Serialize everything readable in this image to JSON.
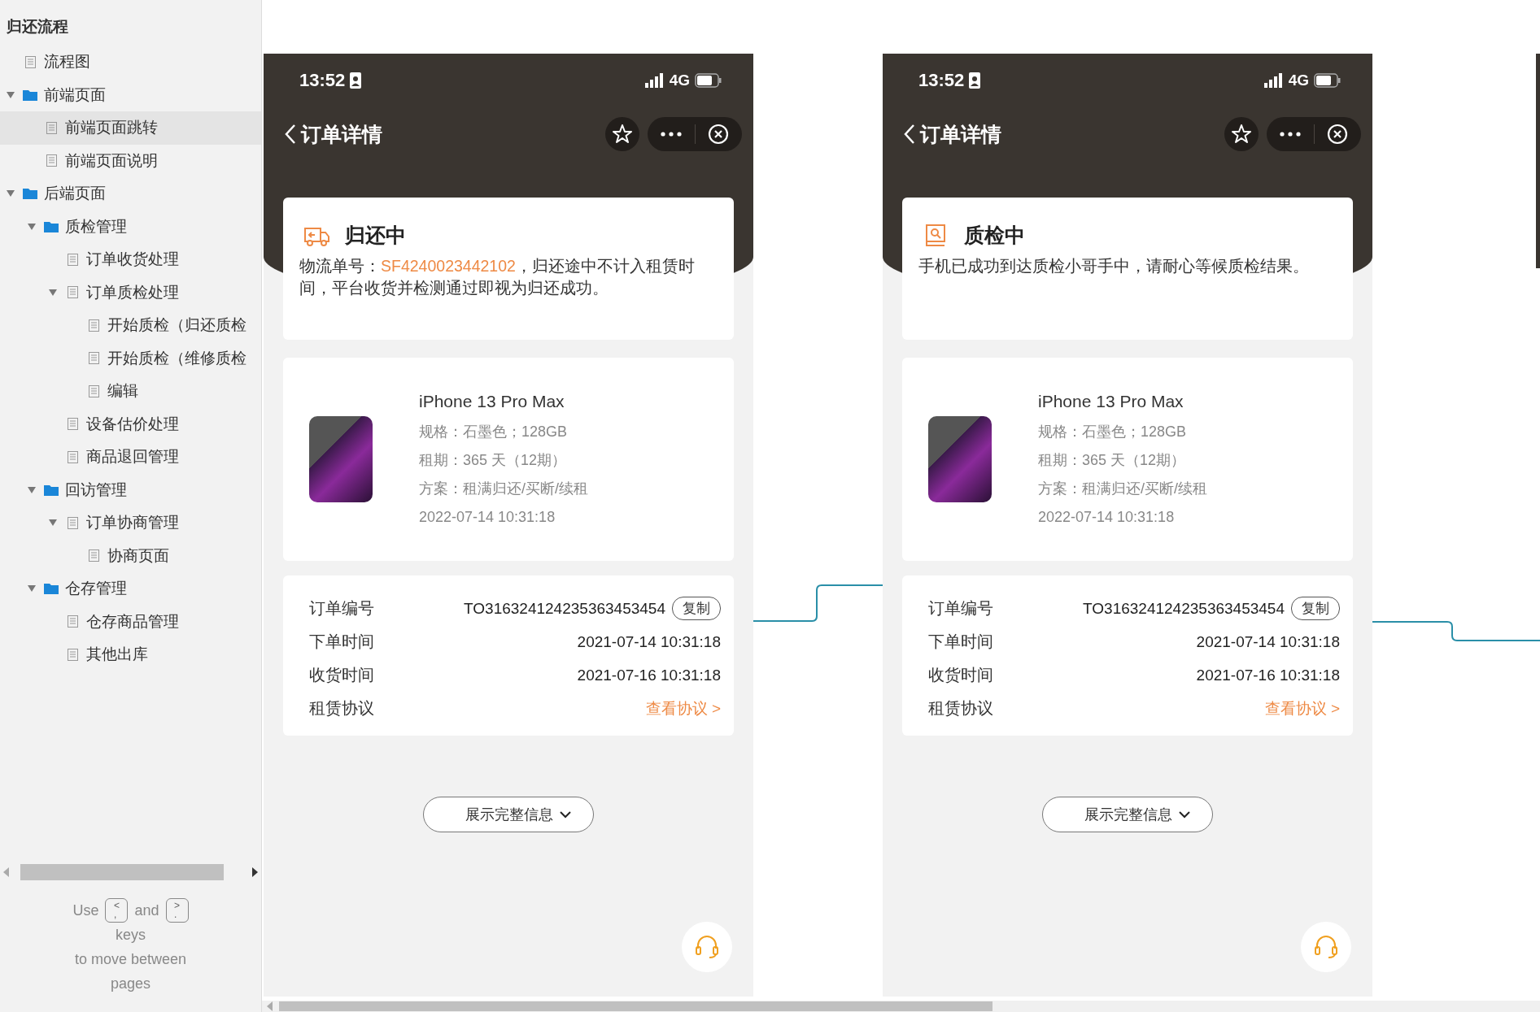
{
  "sidebar": {
    "title": "归还流程",
    "tree": [
      {
        "label": "流程图",
        "kind": "page",
        "selected": false
      },
      {
        "label": "前端页面",
        "kind": "folder",
        "selected": false,
        "expanded": true,
        "children": [
          {
            "label": "前端页面跳转",
            "kind": "page",
            "selected": true
          },
          {
            "label": "前端页面说明",
            "kind": "page",
            "selected": false
          }
        ]
      },
      {
        "label": "后端页面",
        "kind": "folder",
        "selected": false,
        "expanded": true,
        "children": [
          {
            "label": "质检管理",
            "kind": "folder",
            "selected": false,
            "expanded": true,
            "children": [
              {
                "label": "订单收货处理",
                "kind": "page",
                "selected": false
              },
              {
                "label": "订单质检处理",
                "kind": "page",
                "selected": false,
                "expanded": true,
                "children": [
                  {
                    "label": "开始质检（归还质检",
                    "kind": "page",
                    "selected": false
                  },
                  {
                    "label": "开始质检（维修质检",
                    "kind": "page",
                    "selected": false
                  },
                  {
                    "label": "编辑",
                    "kind": "page",
                    "selected": false
                  }
                ]
              },
              {
                "label": "设备估价处理",
                "kind": "page",
                "selected": false
              },
              {
                "label": "商品退回管理",
                "kind": "page",
                "selected": false
              }
            ]
          },
          {
            "label": "回访管理",
            "kind": "folder",
            "selected": false,
            "expanded": true,
            "children": [
              {
                "label": "订单协商管理",
                "kind": "page",
                "selected": false,
                "expanded": true,
                "children": [
                  {
                    "label": "协商页面",
                    "kind": "page",
                    "selected": false
                  }
                ]
              }
            ]
          },
          {
            "label": "仓存管理",
            "kind": "folder",
            "selected": false,
            "expanded": true,
            "children": [
              {
                "label": "仓存商品管理",
                "kind": "page",
                "selected": false
              },
              {
                "label": "其他出库",
                "kind": "page",
                "selected": false
              }
            ]
          }
        ]
      }
    ],
    "hint": {
      "before": "Use",
      "key_prev": {
        "top": "<",
        "bottom": ","
      },
      "middle": "and",
      "key_next": {
        "top": ">",
        "bottom": "."
      },
      "lines": [
        "keys",
        "to move between",
        "pages"
      ]
    }
  },
  "phones": [
    {
      "status_bar": {
        "time": "13:52",
        "network": "4G"
      },
      "nav": {
        "title": "订单详情"
      },
      "status": {
        "kind": "returning",
        "title": "归还中",
        "description": [
          {
            "text": "物流单号：",
            "highlight": false
          },
          {
            "text": "SF4240023442102",
            "highlight": true
          },
          {
            "text": "，归还途中不计入租赁时间，平台收货并检测通过即视为归还成功。",
            "highlight": false
          }
        ]
      },
      "product": {
        "name": "iPhone 13 Pro Max",
        "lines": [
          "规格：石墨色；128GB",
          "租期：365 天（12期）",
          "方案：租满归还/买断/续租",
          "2022-07-14 10:31:18"
        ]
      },
      "order_info": [
        {
          "kind": "copy",
          "label": "订单编号",
          "value": "TO316324124235363453454",
          "action": "复制"
        },
        {
          "kind": "text",
          "label": "下单时间",
          "value": "2021-07-14 10:31:18"
        },
        {
          "kind": "text",
          "label": "收货时间",
          "value": "2021-07-16 10:31:18"
        },
        {
          "kind": "link",
          "label": "租赁协议",
          "value": "查看协议 >"
        }
      ],
      "expand_button": "展示完整信息"
    },
    {
      "status_bar": {
        "time": "13:52",
        "network": "4G"
      },
      "nav": {
        "title": "订单详情"
      },
      "status": {
        "kind": "inspecting",
        "title": "质检中",
        "description": [
          {
            "text": "手机已成功到达质检小哥手中，请耐心等候质检结果。",
            "highlight": false
          }
        ]
      },
      "product": {
        "name": "iPhone 13 Pro Max",
        "lines": [
          "规格：石墨色；128GB",
          "租期：365 天（12期）",
          "方案：租满归还/买断/续租",
          "2022-07-14 10:31:18"
        ]
      },
      "order_info": [
        {
          "kind": "copy",
          "label": "订单编号",
          "value": "TO316324124235363453454",
          "action": "复制"
        },
        {
          "kind": "text",
          "label": "下单时间",
          "value": "2021-07-14 10:31:18"
        },
        {
          "kind": "text",
          "label": "收货时间",
          "value": "2021-07-16 10:31:18"
        },
        {
          "kind": "link",
          "label": "租赁协议",
          "value": "查看协议 >"
        }
      ],
      "expand_button": "展示完整信息"
    }
  ]
}
